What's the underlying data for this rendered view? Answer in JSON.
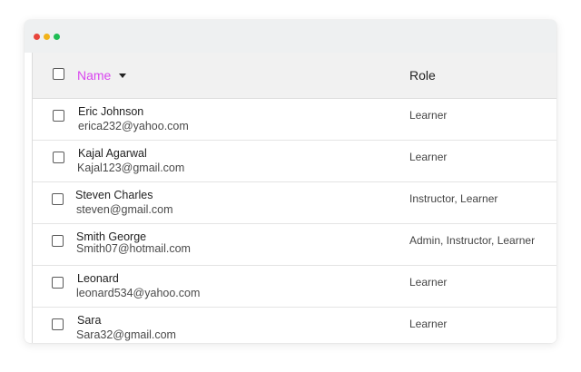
{
  "window": {
    "controls": [
      "close",
      "minimize",
      "maximize"
    ]
  },
  "table": {
    "columns": {
      "name": "Name",
      "role": "Role"
    },
    "sort_icon": "caret-down-icon",
    "rows": [
      {
        "name": "Eric Johnson",
        "email": "erica232@yahoo.com",
        "role": "Learner"
      },
      {
        "name": "Kajal Agarwal",
        "email": "Kajal123@gmail.com",
        "role": "Learner"
      },
      {
        "name": "Steven Charles",
        "email": "steven@gmail.com",
        "role": "Instructor, Learner"
      },
      {
        "name": "Smith George",
        "email": "Smith07@hotmail.com",
        "role": "Admin, Instructor, Learner"
      },
      {
        "name": "Leonard",
        "email": "leonard534@yahoo.com",
        "role": "Learner"
      },
      {
        "name": "Sara",
        "email": "Sara32@gmail.com",
        "role": "Learner"
      }
    ]
  },
  "colors": {
    "accent": "#d946ef",
    "header_bg": "#f1f1f1",
    "titlebar_bg": "#eef0f1",
    "close": "#e8453c",
    "minimize": "#f1b31a",
    "maximize": "#1fbd55"
  }
}
